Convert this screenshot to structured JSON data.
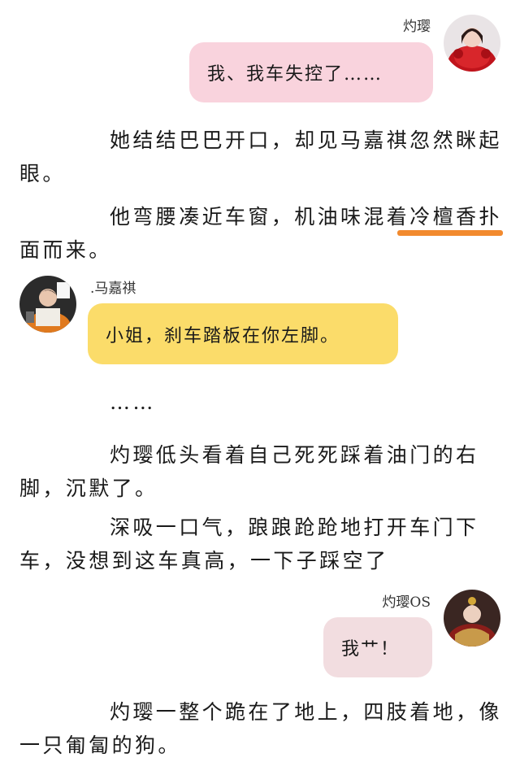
{
  "messages": [
    {
      "sender": "灼璎",
      "text": "我、我车失控了……",
      "side": "right",
      "bubble_color": "#f9d3dd"
    },
    {
      "sender": ".马嘉祺",
      "text": "小姐，刹车踏板在你左脚。",
      "side": "left",
      "bubble_color": "#fbdc6a"
    },
    {
      "sender": "灼璎OS",
      "text": "我艹！",
      "side": "right",
      "bubble_color": "#f2dde0"
    }
  ],
  "paragraphs": [
    "她结结巴巴开口，却见马嘉祺忽然眯起眼。",
    "他弯腰凑近车窗，机油味混着冷檀香扑面而来。",
    "……",
    "灼璎低头看着自己死死踩着油门的右脚，沉默了。",
    "深吸一口气，踉踉跄跄地打开车门下车，没想到这车真高，一下子踩空了",
    "灼璎一整个跪在了地上，四肢着地，像一只匍匐的狗。"
  ],
  "highlight_color": "#f28a2e"
}
